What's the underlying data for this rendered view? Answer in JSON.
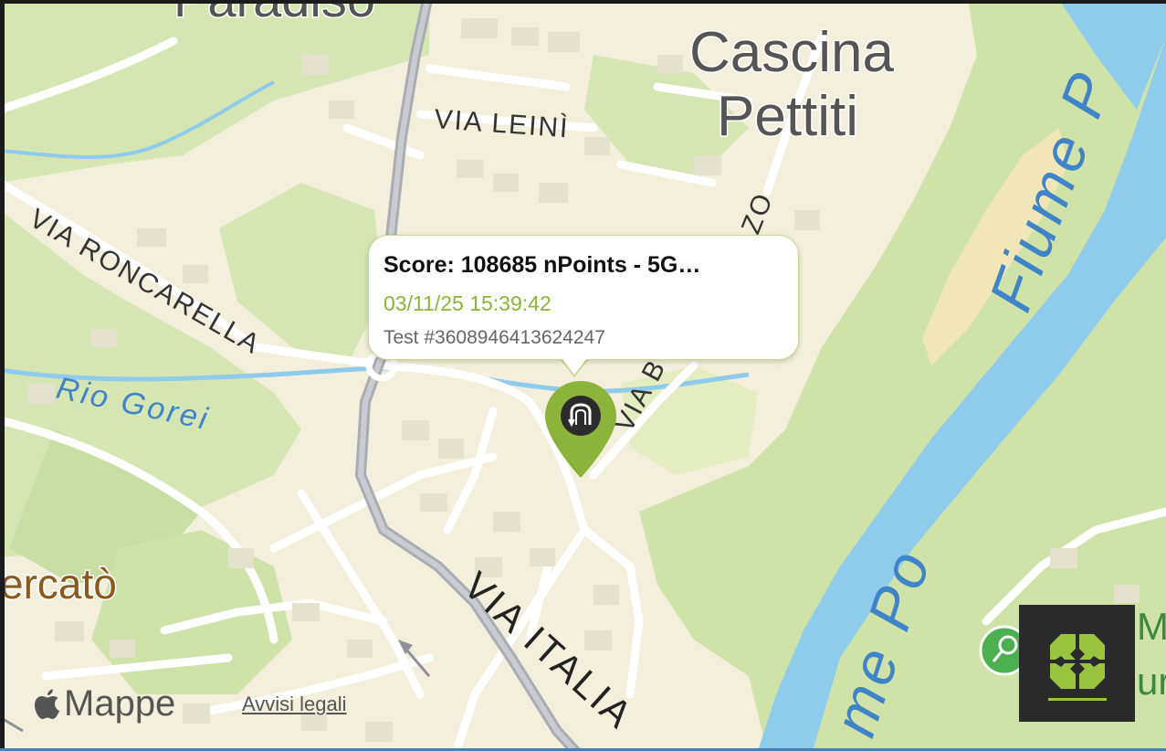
{
  "map": {
    "labels": {
      "paradiso": "Paradiso",
      "cascina": "Cascina",
      "pettiti": "Pettiti",
      "via_leini": "VIA LEINÌ",
      "via_roncarella": "VIA RONCARELLA",
      "rio_gorei": "Rio Gorei",
      "via_italia": "VIA ITALIA",
      "via_b": "VIA B",
      "zo": "ZO",
      "fiume_po_top": "Fiume P",
      "fiume_po_bottom": "me Po",
      "mercato": "ercatò",
      "poi_m": "M",
      "poi_ur": "ur"
    }
  },
  "popup": {
    "title": "Score: 108685 nPoints - 5G…",
    "datetime": "03/11/25 15:39:42",
    "test_id": "Test #3608946413624247"
  },
  "attribution": {
    "brand": "Mappe",
    "legal_link": "Avvisi legali"
  },
  "colors": {
    "land": "#f3efdc",
    "park": "#d5e6b2",
    "river": "#8fcbea",
    "river_label": "#3f83c9",
    "marker": "#8db43a",
    "accent": "#9ac33f"
  },
  "icons": {
    "marker": "map-pin-icon",
    "marker_inner": "speedtest-icon",
    "app_button": "clover-logo-icon",
    "tennis": "tennis-icon"
  }
}
